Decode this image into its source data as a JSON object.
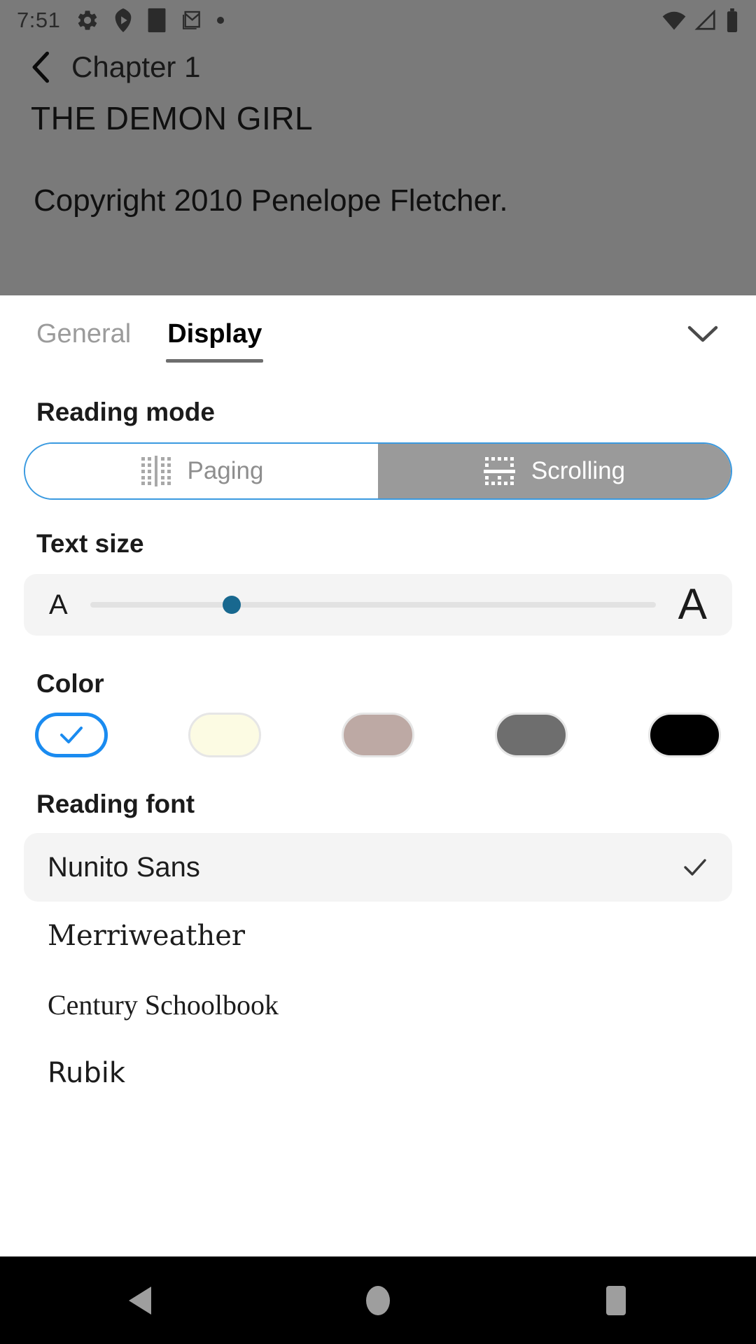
{
  "status_bar": {
    "time": "7:51",
    "left_icons": [
      "gear-icon",
      "shield-play-icon",
      "square-icon",
      "gmail-icon",
      "dot-icon"
    ],
    "right_icons": [
      "wifi-icon",
      "cell-signal-icon",
      "battery-icon"
    ]
  },
  "app_bar": {
    "back_icon": "back-chevron-icon",
    "title": "Chapter 1"
  },
  "book": {
    "title": "THE DEMON GIRL",
    "copyright": "Copyright 2010 Penelope Fletcher."
  },
  "sheet": {
    "tabs": [
      {
        "label": "General",
        "active": false
      },
      {
        "label": "Display",
        "active": true
      }
    ],
    "collapse_icon": "chevron-down-icon",
    "reading_mode": {
      "title": "Reading mode",
      "options": [
        {
          "label": "Paging",
          "icon": "paging-icon",
          "selected": false
        },
        {
          "label": "Scrolling",
          "icon": "scrolling-icon",
          "selected": true
        }
      ]
    },
    "text_size": {
      "title": "Text size",
      "min_label": "A",
      "max_label": "A",
      "value_percent": 25
    },
    "color": {
      "title": "Color",
      "swatches": [
        {
          "name": "white",
          "hex": "#ffffff",
          "selected": true,
          "check_icon": "check-icon"
        },
        {
          "name": "sepia-light",
          "hex": "#fcfbe3",
          "selected": false
        },
        {
          "name": "rose",
          "hex": "#bda9a4",
          "selected": false
        },
        {
          "name": "gray",
          "hex": "#6e6e6e",
          "selected": false
        },
        {
          "name": "black",
          "hex": "#000000",
          "selected": false
        }
      ]
    },
    "reading_font": {
      "title": "Reading font",
      "fonts": [
        {
          "label": "Nunito Sans",
          "selected": true,
          "check_icon": "check-icon"
        },
        {
          "label": "Merriweather",
          "selected": false
        },
        {
          "label": "Century Schoolbook",
          "selected": false
        },
        {
          "label": "Rubik",
          "selected": false
        }
      ]
    }
  },
  "nav_bar": {
    "buttons": [
      {
        "name": "back",
        "icon": "nav-back-triangle-icon"
      },
      {
        "name": "home",
        "icon": "nav-home-circle-icon"
      },
      {
        "name": "recents",
        "icon": "nav-recents-square-icon"
      }
    ]
  },
  "colors": {
    "accent_blue": "#1a8bf0",
    "segment_border": "#3a9ae0",
    "slider_thumb": "#18688f",
    "dim_overlay": "#7a7a7a"
  }
}
